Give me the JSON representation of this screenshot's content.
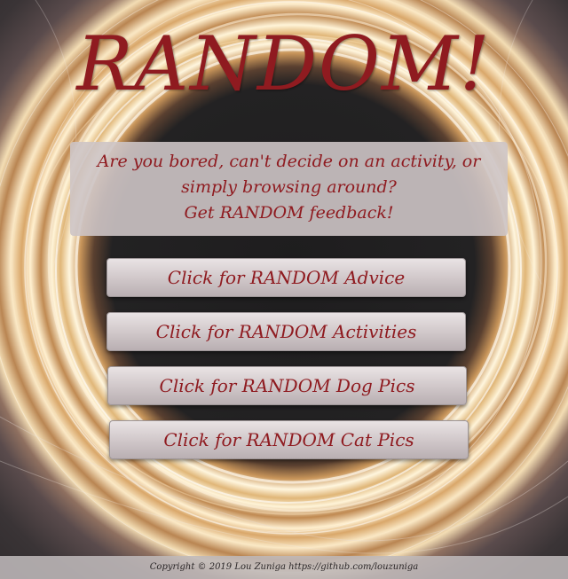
{
  "title": "RANDOM!",
  "intro": {
    "line1": "Are you bored, can't decide on an activity, or",
    "line2": "simply browsing around?",
    "line3": "Get RANDOM feedback!"
  },
  "buttons": {
    "advice": "Click for RANDOM Advice",
    "activities": "Click for RANDOM Activities",
    "dog_pics": "Click for RANDOM Dog Pics",
    "cat_pics": "Click for RANDOM Cat Pics"
  },
  "footer": {
    "text": "Copyright © 2019 Lou Zuniga https://github.com/louzuniga"
  },
  "colors": {
    "accent": "#8f1b20",
    "panel": "#cdc4c5",
    "background": "#1c1b1c"
  }
}
